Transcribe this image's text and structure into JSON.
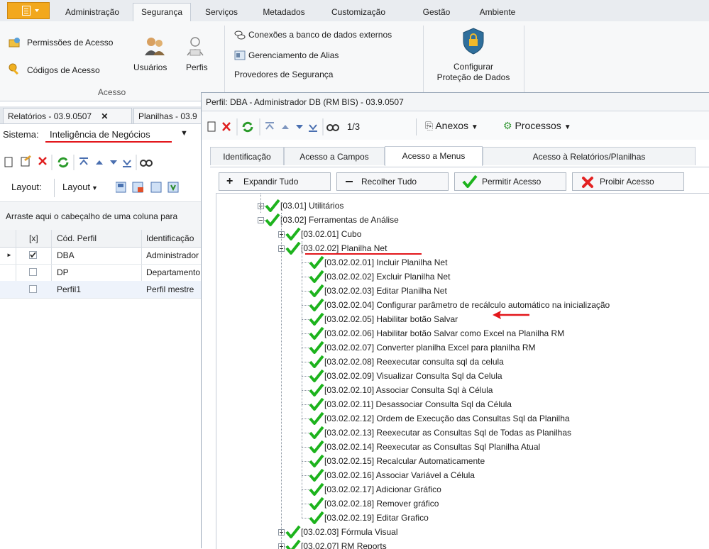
{
  "ribbon": {
    "tabs": [
      "Administração",
      "Segurança",
      "Serviços",
      "Metadados",
      "Customização",
      "Gestão",
      "Ambiente"
    ],
    "active_tab": "Segurança",
    "acesso_group": {
      "permissoes": "Permissões de Acesso",
      "codigos": "Códigos de Acesso",
      "usuarios": "Usuários",
      "perfis": "Perfis",
      "label": "Acesso"
    },
    "links": {
      "conexoes": "Conexões a banco de dados externos",
      "alias": "Gerenciamento de Alias",
      "provedores": "Provedores de Segurança"
    },
    "protecao": {
      "line1": "Configurar",
      "line2": "Proteção de Dados"
    }
  },
  "left": {
    "doc_tabs": [
      "Relatórios - 03.9.0507",
      "Planilhas - 03.9"
    ],
    "sistema_label": "Sistema:",
    "sistema_value": "Inteligência de Negócios",
    "layout_label": "Layout:",
    "layout_dropdown": "Layout",
    "group_hint": "Arraste aqui o cabeçalho de uma coluna para",
    "columns": [
      "[x]",
      "Cód. Perfil",
      "Identificação"
    ],
    "rows": [
      {
        "checked": true,
        "cod": "DBA",
        "ident": "Administrador DB"
      },
      {
        "checked": false,
        "cod": "DP",
        "ident": "Departamento Pessoal"
      },
      {
        "checked": false,
        "cod": "Perfil1",
        "ident": "Perfil mestre"
      }
    ]
  },
  "dialog": {
    "title": "Perfil: DBA - Administrador DB (RM BIS) - 03.9.0507",
    "record_pos": "1/3",
    "anexos": "Anexos",
    "processos": "Processos",
    "tabs": [
      "Identificação",
      "Acesso a Campos",
      "Acesso a Menus",
      "Acesso à Relatórios/Planilhas"
    ],
    "active_tab": "Acesso a Menus",
    "buttons": {
      "expandir": "Expandir Tudo",
      "recolher": "Recolher Tudo",
      "permitir": "Permitir Acesso",
      "proibir": "Proibir Acesso"
    },
    "tree": [
      {
        "text": "[03.01] Utilitários",
        "level": 0,
        "exp": "plus"
      },
      {
        "text": "[03.02] Ferramentas de Análise",
        "level": 0,
        "exp": "minus"
      },
      {
        "text": "[03.02.01] Cubo",
        "level": 1,
        "exp": "plus"
      },
      {
        "text": "[03.02.02] Planilha Net",
        "level": 1,
        "exp": "minus"
      },
      {
        "text": "[03.02.02.01] Incluir Planilha Net",
        "level": 2,
        "exp": ""
      },
      {
        "text": "[03.02.02.02] Excluir Planilha Net",
        "level": 2,
        "exp": ""
      },
      {
        "text": "[03.02.02.03] Editar Planilha Net",
        "level": 2,
        "exp": ""
      },
      {
        "text": "[03.02.02.04] Configurar parâmetro de recálculo automático na inicialização",
        "level": 2,
        "exp": ""
      },
      {
        "text": "[03.02.02.05] Habilitar botão Salvar",
        "level": 2,
        "exp": ""
      },
      {
        "text": "[03.02.02.06] Habilitar botão Salvar como Excel na Planilha RM",
        "level": 2,
        "exp": ""
      },
      {
        "text": "[03.02.02.07] Converter planilha Excel para planilha RM",
        "level": 2,
        "exp": ""
      },
      {
        "text": "[03.02.02.08] Reexecutar consulta sql da celula",
        "level": 2,
        "exp": ""
      },
      {
        "text": "[03.02.02.09] Visualizar Consulta Sql da Celula",
        "level": 2,
        "exp": ""
      },
      {
        "text": "[03.02.02.10] Associar Consulta Sql à Célula",
        "level": 2,
        "exp": ""
      },
      {
        "text": "[03.02.02.11] Desassociar Consulta Sql da Célula",
        "level": 2,
        "exp": ""
      },
      {
        "text": "[03.02.02.12] Ordem de Execução das Consultas Sql  da Planilha",
        "level": 2,
        "exp": ""
      },
      {
        "text": "[03.02.02.13] Reexecutar as Consultas Sql de Todas as Planilhas",
        "level": 2,
        "exp": ""
      },
      {
        "text": "[03.02.02.14] Reexecutar as Consultas Sql Planilha Atual",
        "level": 2,
        "exp": ""
      },
      {
        "text": "[03.02.02.15] Recalcular Automaticamente",
        "level": 2,
        "exp": ""
      },
      {
        "text": "[03.02.02.16] Associar Variável a Célula",
        "level": 2,
        "exp": ""
      },
      {
        "text": "[03.02.02.17] Adicionar Gráfico",
        "level": 2,
        "exp": ""
      },
      {
        "text": "[03.02.02.18] Remover gráfico",
        "level": 2,
        "exp": ""
      },
      {
        "text": "[03.02.02.19] Editar Grafico",
        "level": 2,
        "exp": ""
      },
      {
        "text": "[03.02.03] Fórmula Visual",
        "level": 1,
        "exp": "plus"
      },
      {
        "text": "[03.02.07] RM Reports",
        "level": 1,
        "exp": "plus"
      }
    ]
  },
  "colors": {
    "ribbon_orange": "#f2a81d",
    "check_green": "#1db31d",
    "annotation_red": "#e3161b"
  }
}
